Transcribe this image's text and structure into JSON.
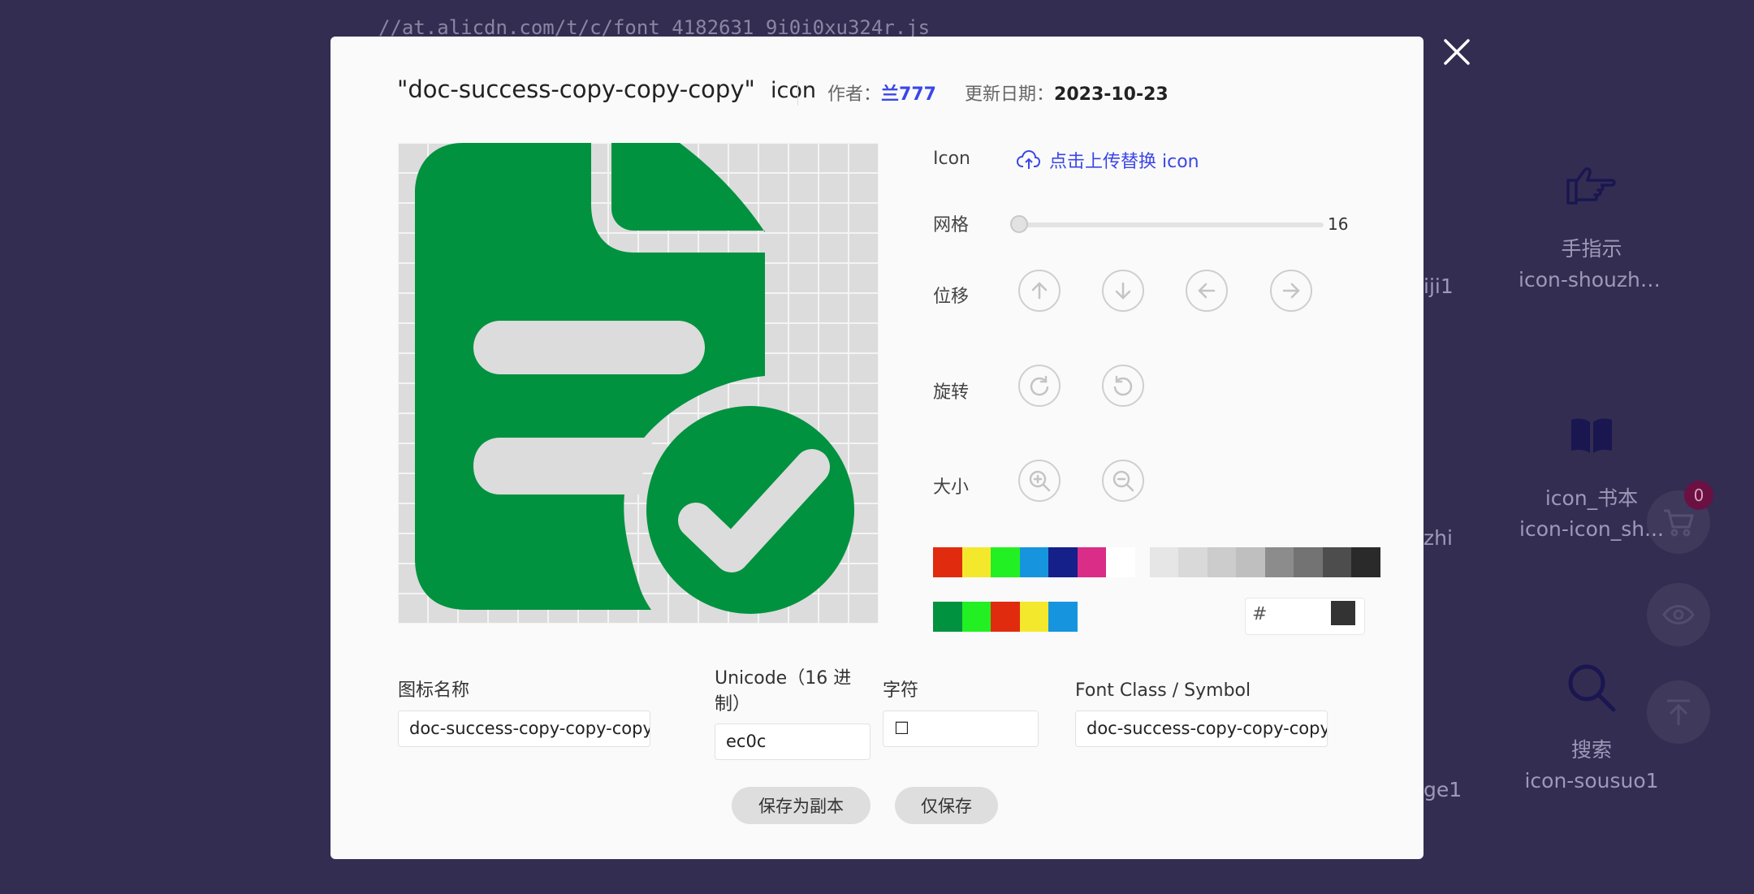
{
  "background": {
    "url_text": "//at.alicdn.com/t/c/font_4182631_9i0i0xu324r.js",
    "items": [
      {
        "label": "手指示",
        "code": "icon-shouzhi..."
      },
      {
        "label": "icon_书本",
        "code": "icon-icon_sh..."
      },
      {
        "label": "搜索",
        "code": "icon-sousuo1"
      }
    ],
    "partials": [
      "iji1",
      "zhi",
      "ge1"
    ],
    "cart_count": "0"
  },
  "modal": {
    "title_name": "\"doc-success-copy-copy-copy\"",
    "title_suffix": "icon",
    "author_label": "作者：",
    "author_value": "兰777",
    "date_label": "更新日期：",
    "date_value": "2023-10-23",
    "icon_color": "#00923f",
    "controls": {
      "icon_label": "Icon",
      "upload_label": "点击上传替换 icon",
      "grid_label": "网格",
      "grid_value": "16",
      "move_label": "位移",
      "rotate_label": "旋转",
      "size_label": "大小"
    },
    "palette_row1": [
      "#e02b0f",
      "#f4e82d",
      "#23f023",
      "#1695de",
      "#15208a",
      "#d92d87",
      "#ffffff",
      "#e6e6e6",
      "#d9d9d9",
      "#cccccc",
      "#bfbfbf",
      "#8c8c8c",
      "#737373",
      "#4d4d4d",
      "#2a2a2a"
    ],
    "palette_row2": [
      "#00923f",
      "#23f023",
      "#e02b0f",
      "#f4e82d",
      "#1695de"
    ],
    "hex_prefix": "#",
    "hex_value": "",
    "hex_preview": "#333333",
    "fields": {
      "name_label": "图标名称",
      "name_value": "doc-success-copy-copy-copy",
      "unicode_label": "Unicode（16 进制）",
      "unicode_value": "ec0c",
      "char_label": "字符",
      "char_value": "☐",
      "class_label": "Font Class / Symbol",
      "class_value": "doc-success-copy-copy-copy"
    },
    "buttons": {
      "save_copy": "保存为副本",
      "save_only": "仅保存"
    }
  }
}
